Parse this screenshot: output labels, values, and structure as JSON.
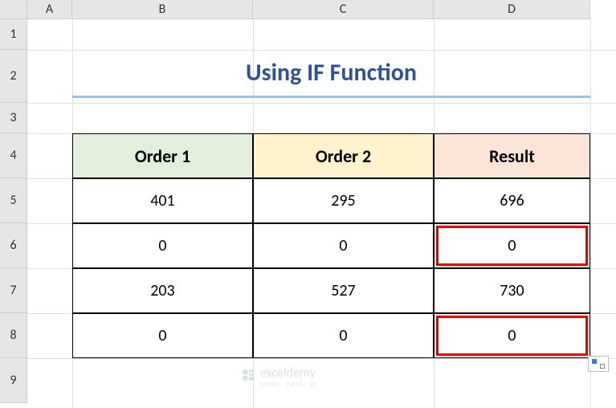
{
  "columns": [
    "A",
    "B",
    "C",
    "D"
  ],
  "rows": [
    "1",
    "2",
    "3",
    "4",
    "5",
    "6",
    "7",
    "8",
    "9"
  ],
  "title": "Using IF Function",
  "headers": {
    "b": "Order 1",
    "c": "Order 2",
    "d": "Result"
  },
  "data": [
    {
      "b": "401",
      "c": "295",
      "d": "696"
    },
    {
      "b": "0",
      "c": "0",
      "d": "0"
    },
    {
      "b": "203",
      "c": "527",
      "d": "730"
    },
    {
      "b": "0",
      "c": "0",
      "d": "0"
    }
  ],
  "watermark": {
    "brand": "exceldemy",
    "tagline": "EXCEL · DATA · BI"
  }
}
